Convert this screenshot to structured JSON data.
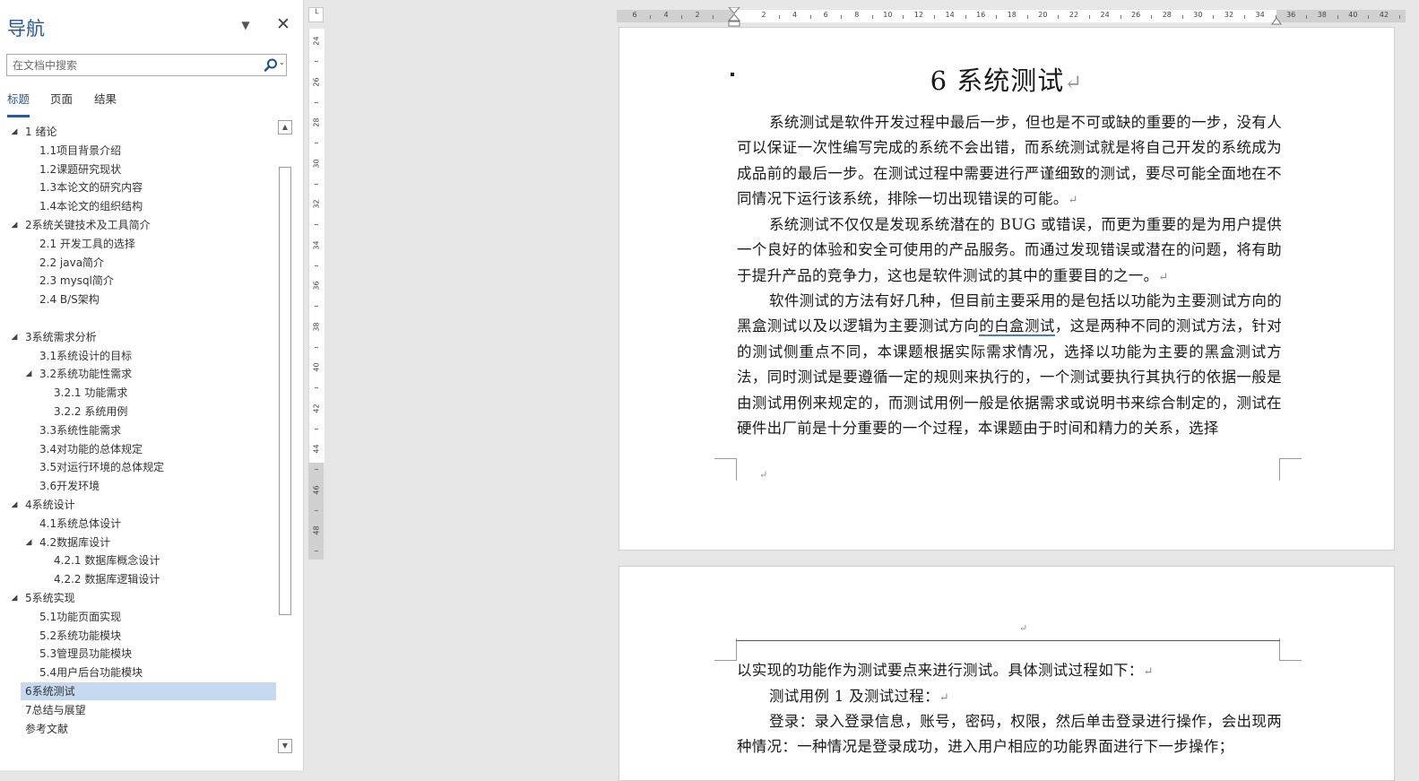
{
  "nav": {
    "title": "导航",
    "search_placeholder": "在文档中搜索",
    "tabs": [
      "标题",
      "页面",
      "结果"
    ],
    "items": [
      {
        "label": "1 绪论",
        "level": 1,
        "expanded": true
      },
      {
        "label": "1.1项目背景介绍",
        "level": 2
      },
      {
        "label": "1.2课题研究现状",
        "level": 2
      },
      {
        "label": "1.3本论文的研究内容",
        "level": 2
      },
      {
        "label": "1.4本论文的组织结构",
        "level": 2
      },
      {
        "label": "2系统关键技术及工具简介",
        "level": 1,
        "expanded": true
      },
      {
        "label": "2.1 开发工具的选择",
        "level": 2
      },
      {
        "label": "2.2 java简介",
        "level": 2
      },
      {
        "label": "2.3 mysql简介",
        "level": 2
      },
      {
        "label": "2.4 B/S架构",
        "level": 2
      },
      {
        "label": "",
        "level": 2
      },
      {
        "label": "3系统需求分析",
        "level": 1,
        "expanded": true
      },
      {
        "label": "3.1系统设计的目标",
        "level": 2
      },
      {
        "label": "3.2系统功能性需求",
        "level": 2,
        "expanded": true
      },
      {
        "label": "3.2.1 功能需求",
        "level": 3
      },
      {
        "label": "3.2.2 系统用例",
        "level": 3
      },
      {
        "label": "3.3系统性能需求",
        "level": 2
      },
      {
        "label": "3.4对功能的总体规定",
        "level": 2
      },
      {
        "label": "3.5对运行环境的总体规定",
        "level": 2
      },
      {
        "label": "3.6开发环境",
        "level": 2
      },
      {
        "label": "4系统设计",
        "level": 1,
        "expanded": true
      },
      {
        "label": "4.1系统总体设计",
        "level": 2
      },
      {
        "label": "4.2数据库设计",
        "level": 2,
        "expanded": true
      },
      {
        "label": "4.2.1 数据库概念设计",
        "level": 3
      },
      {
        "label": "4.2.2 数据库逻辑设计",
        "level": 3
      },
      {
        "label": "5系统实现",
        "level": 1,
        "expanded": true
      },
      {
        "label": "5.1功能页面实现",
        "level": 2
      },
      {
        "label": "5.2系统功能模块",
        "level": 2
      },
      {
        "label": "5.3管理员功能模块",
        "level": 2
      },
      {
        "label": "5.4用户后台功能模块",
        "level": 2
      },
      {
        "label": "6系统测试",
        "level": 1,
        "selected": true
      },
      {
        "label": "7总结与展望",
        "level": 1
      },
      {
        "label": "参考文献",
        "level": 1
      }
    ]
  },
  "rulers": {
    "vertical_labels": [
      "24",
      "26",
      "28",
      "30",
      "32",
      "34",
      "36",
      "38",
      "40",
      "42",
      "44",
      "46",
      "48"
    ],
    "horizontal_labels": [
      "6",
      "4",
      "2",
      "2",
      "4",
      "6",
      "8",
      "10",
      "12",
      "14",
      "16",
      "18",
      "20",
      "22",
      "24",
      "26",
      "28",
      "30",
      "32",
      "34",
      "36",
      "38",
      "40",
      "42"
    ]
  },
  "document": {
    "heading": "6 系统测试",
    "page1_paragraphs": [
      "系统测试是软件开发过程中最后一步，但也是不可或缺的重要的一步，没有人可以保证一次性编写完成的系统不会出错，而系统测试就是将自己开发的系统成为成品前的最后一步。在测试过程中需要进行严谨细致的测试，要尽可能全面地在不同情况下运行该系统，排除一切出现错误的可能。",
      "系统测试不仅仅是发现系统潜在的 BUG 或错误，而更为重要的是为用户提供一个良好的体验和安全可使用的产品服务。而通过发现错误或潜在的问题，将有助于提升产品的竞争力，这也是软件测试的其中的重要目的之一。"
    ],
    "para3_part1": "软件测试的方法有好几种，但目前主要采用的是包括以功能为主要测试方向的黑盒测试以及以逻辑为主要测试方向",
    "para3_underlined": "的白盒测试",
    "para3_part2": "，这是两种不同的测试方法，针对的测试侧重点不同，本课题根据实际需求情况，选择以功能为主要的黑盒测试方法，同时测试是要遵循一定的规则来执行的，一个测试要执行其执行的依据一般是由测试用例来规定的，而测试用例一般是依据需求或说明书来综合制定的，测试在硬件出厂前是十分重要的一个过程，本课题由于时间和精力的关系，选择",
    "page2_line1": "以实现的功能作为测试要点来进行测试。具体测试过程如下：",
    "page2_line2": "测试用例 1 及测试过程：",
    "page2_line3": "登录：录入登录信息，账号，密码，权限，然后单击登录进行操作，会出现两种情况：一种情况是登录成功，进入用户相应的功能界面进行下一步操作；",
    "para_mark": "↵"
  },
  "colors": {
    "accent": "#2b579a",
    "selection": "#c5d9f1",
    "spellcheck_underline": "#4a79c9"
  }
}
